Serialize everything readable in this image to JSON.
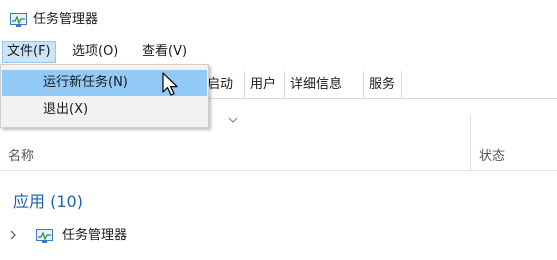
{
  "window": {
    "title": "任务管理器"
  },
  "menubar": {
    "file": "文件(F)",
    "options": "选项(O)",
    "view": "查看(V)"
  },
  "file_menu": {
    "items": [
      {
        "label": "运行新任务(N)"
      },
      {
        "label": "退出(X)"
      }
    ]
  },
  "tabs": [
    "启动",
    "用户",
    "详细信息",
    "服务"
  ],
  "columns": {
    "name": "名称",
    "status": "状态"
  },
  "group": {
    "title": "应用 (10)"
  },
  "rows": [
    {
      "label": "任务管理器"
    }
  ],
  "colors": {
    "group_title": "#1a63b3",
    "menu_highlight": "#91c9f7",
    "menu_open": "#cce4f7"
  },
  "icons": {
    "app": "task-manager-icon",
    "expand": "chevron-right-icon",
    "sort": "chevron-down-icon",
    "cursor": "mouse-pointer-icon"
  }
}
